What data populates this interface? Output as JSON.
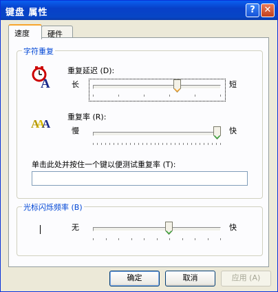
{
  "window": {
    "title": "键盘 属性",
    "help_glyph": "?",
    "close_glyph": "✕"
  },
  "tabs": [
    {
      "label": "速度",
      "active": true
    },
    {
      "label": "硬件",
      "active": false
    }
  ],
  "char_repeat": {
    "group_label": "字符重复",
    "repeat_delay": {
      "label": "重复延迟 (D):",
      "min_label": "长",
      "max_label": "短",
      "value_fraction": 0.67
    },
    "repeat_rate": {
      "label": "重复率 (R):",
      "min_label": "慢",
      "max_label": "快",
      "value_fraction": 1.0
    },
    "test_label": "单击此处并按住一个键以便测试重复率 (T):",
    "test_value": ""
  },
  "cursor_blink": {
    "group_label": "光标闪烁频率 (B)",
    "min_label": "无",
    "max_label": "快",
    "value_fraction": 0.6
  },
  "buttons": {
    "ok": "确定",
    "cancel": "取消",
    "apply": "应用 (A)"
  },
  "colors": {
    "title_bar": "#0a5ff0",
    "group_label": "#0046d5",
    "active_tab_accent": "#f7a42b",
    "dialog_bg": "#ece9d8"
  }
}
